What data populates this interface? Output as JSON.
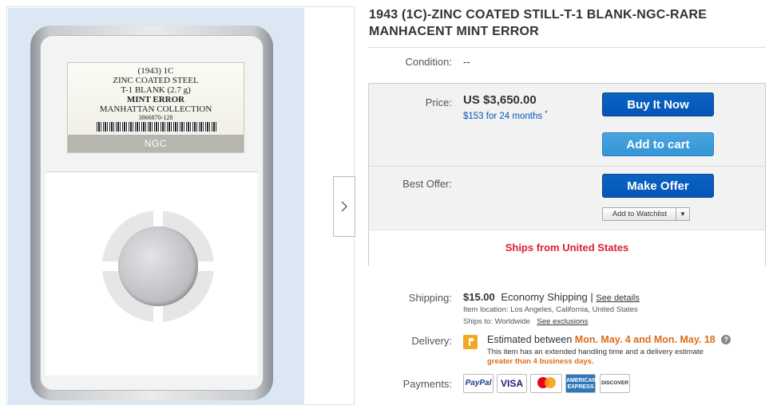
{
  "listing": {
    "title": "1943 (1C)-ZINC COATED STILL-T-1 BLANK-NGC-RARE MANHACENT MINT ERROR"
  },
  "photo": {
    "label_lines": [
      "(1943)  1C",
      "ZINC COATED STEEL",
      "T-1 BLANK (2.7 g)",
      "MINT ERROR",
      "MANHATTAN COLLECTION",
      "3866870-128"
    ],
    "grader_logo": "NGC",
    "next_icon": "chevron-right-icon"
  },
  "condition": {
    "label": "Condition:",
    "value": "--"
  },
  "price": {
    "label": "Price:",
    "value": "US $3,650.00",
    "financing": "$153 for 24 months"
  },
  "buttons": {
    "buy_now": "Buy It Now",
    "add_to_cart": "Add to cart",
    "make_offer": "Make Offer",
    "watchlist": "Add to Watchlist"
  },
  "best_offer": {
    "label": "Best Offer:"
  },
  "ships_from": "Ships from United States",
  "shipping": {
    "label": "Shipping:",
    "cost": "$15.00",
    "method": "Economy Shipping |",
    "details_link": "See details",
    "location": "Item location:  Los Angeles, California, United States",
    "ships_to": "Ships to:  Worldwide",
    "exclusions_link": "See exclusions"
  },
  "delivery": {
    "label": "Delivery:",
    "prefix": "Estimated between",
    "dates": "Mon. May. 4 and Mon. May. 18",
    "note": "This item has an extended handling time and a delivery estimate",
    "note_emphasis": "greater than 4 business days."
  },
  "payments": {
    "label": "Payments:",
    "methods": [
      "PayPal",
      "VISA",
      "Mastercard",
      "AMERICAN EXPRESS",
      "DISCOVER"
    ]
  },
  "colors": {
    "link_blue": "#0654ba",
    "buy_button": "#0654ba",
    "cart_button": "#3396d6",
    "ships_red": "#dd1e31",
    "delivery_orange": "#dd6d19"
  }
}
